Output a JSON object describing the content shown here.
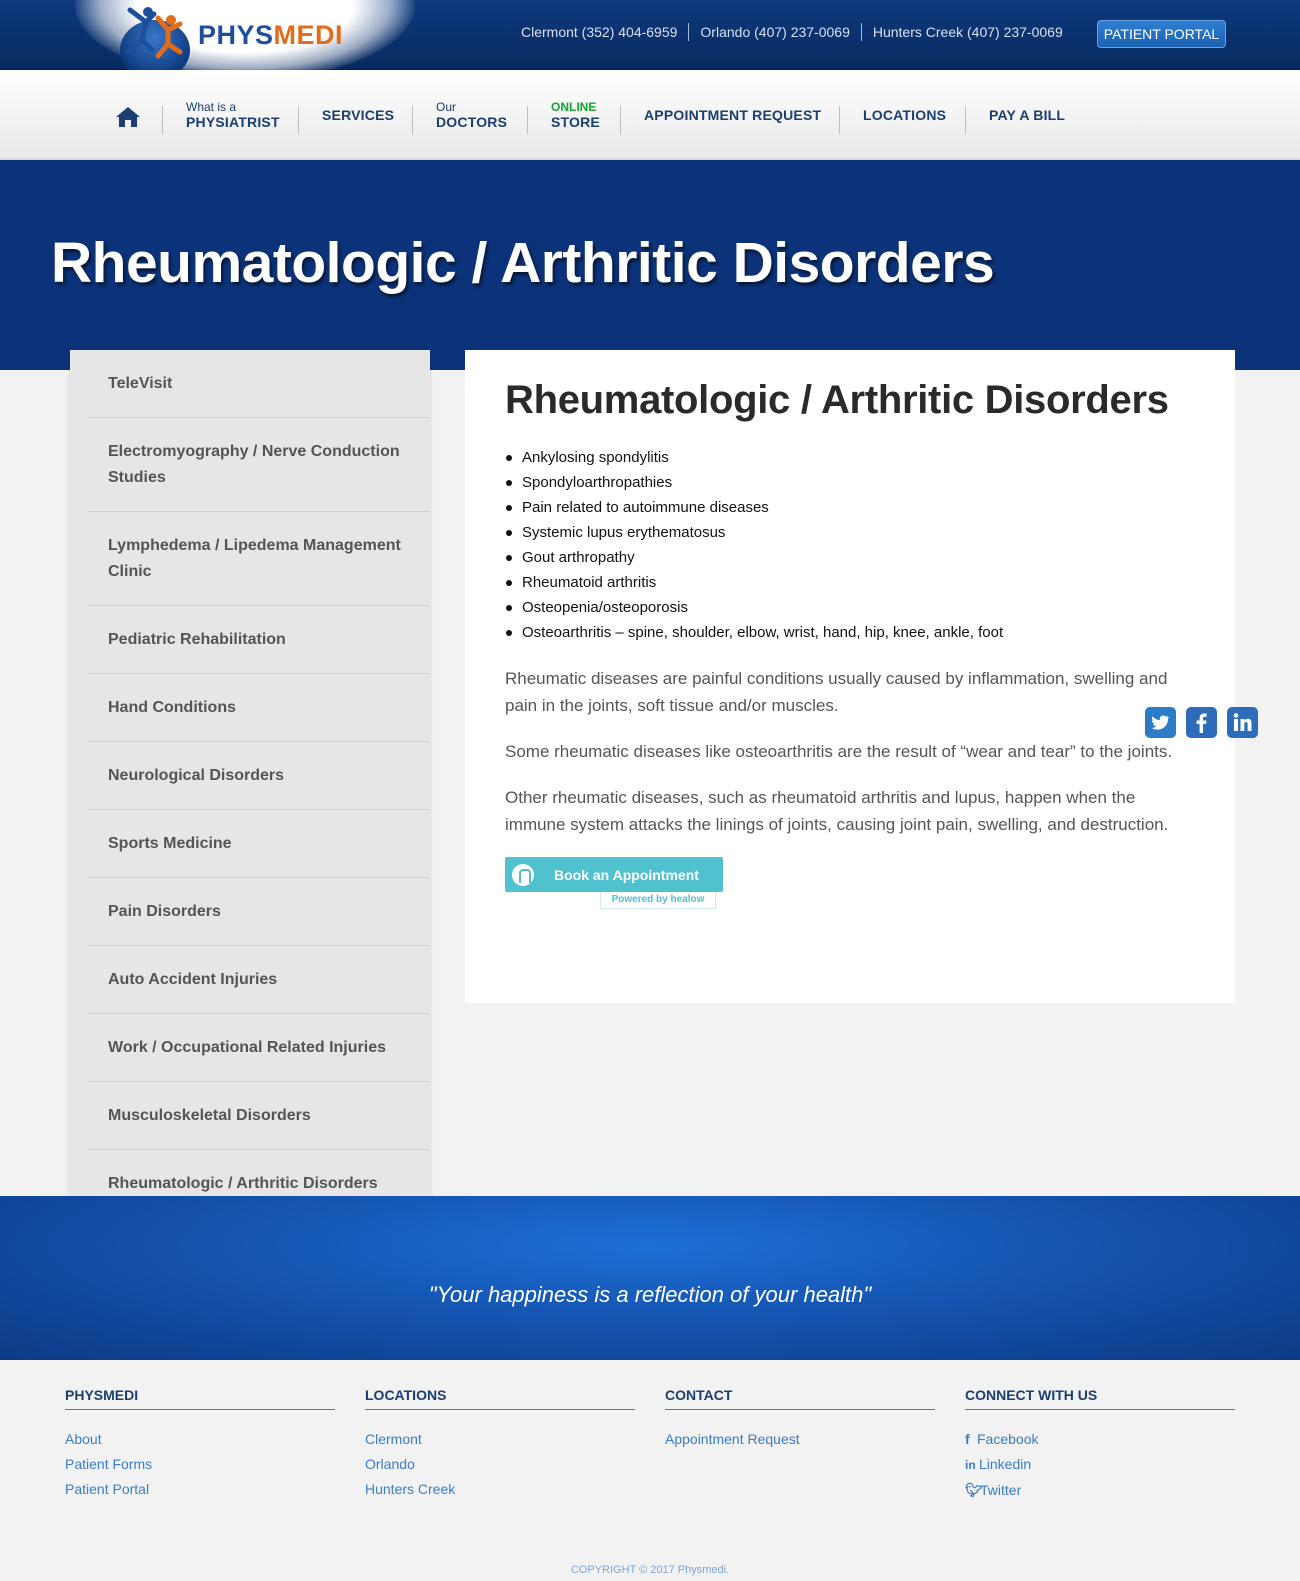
{
  "header": {
    "logo_part1": "PHYS",
    "logo_part2": "MEDI",
    "phones": [
      "Clermont (352) 404-6959",
      "Orlando (407) 237-0069",
      "Hunters Creek (407) 237-0069"
    ],
    "portal_label": "PATIENT PORTAL"
  },
  "nav": {
    "physiatrist_small": "What is a",
    "physiatrist_main": "PHYSIATRIST",
    "services": "SERVICES",
    "doctors_small": "Our",
    "doctors_main": "DOCTORS",
    "store_small": "ONLINE",
    "store_main": "STORE",
    "appointment": "APPOINTMENT REQUEST",
    "locations": "LOCATIONS",
    "pay": "PAY A BILL"
  },
  "hero": {
    "title": "Rheumatologic / Arthritic Disorders"
  },
  "sidebar": {
    "items": [
      "TeleVisit",
      "Electromyography / Nerve Conduction Studies",
      "Lymphedema / Lipedema Management Clinic",
      "Pediatric Rehabilitation",
      "Hand Conditions",
      "Neurological Disorders",
      "Sports Medicine",
      "Pain Disorders",
      "Auto Accident Injuries",
      "Work / Occupational Related Injuries",
      "Musculoskeletal Disorders",
      "Rheumatologic / Arthritic Disorders"
    ]
  },
  "content": {
    "heading": "Rheumatologic / Arthritic Disorders",
    "list": [
      "Ankylosing spondylitis",
      "Spondyloarthropathies",
      "Pain related to autoimmune diseases",
      "Systemic lupus erythematosus",
      "Gout arthropathy",
      "Rheumatoid arthritis",
      "Osteopenia/osteoporosis",
      "Osteoarthritis – spine, shoulder, elbow, wrist, hand, hip, knee, ankle, foot"
    ],
    "paragraphs": [
      "Rheumatic diseases are painful conditions usually caused by inflammation, swelling and pain in the joints, soft tissue and/or muscles.",
      "Some rheumatic diseases like osteoarthritis are the result of “wear and tear” to the joints.",
      "Other rheumatic diseases, such as rheumatoid arthritis and lupus, happen when the immune system attacks the linings of joints, causing joint pain, swelling, and destruction."
    ],
    "book_label": "Book an Appointment",
    "powered_label": "Powered by healow"
  },
  "social": {
    "icons": [
      "twitter-icon",
      "facebook-icon",
      "linkedin-icon"
    ]
  },
  "quote": "\"Your happiness is a reflection of your health\"",
  "footer": {
    "col1_title": "PHYSMEDI",
    "col1_links": [
      "About",
      "Patient Forms",
      "Patient Portal"
    ],
    "col2_title": "LOCATIONS",
    "col2_links": [
      "Clermont",
      "Orlando",
      "Hunters Creek"
    ],
    "col3_title": "CONTACT",
    "col3_links": [
      "Appointment Request"
    ],
    "col4_title": "CONNECT WITH US",
    "col4_links": [
      "Facebook",
      "Linkedin",
      "Twitter"
    ],
    "copyright": "COPYRIGHT © 2017 Physmedi."
  },
  "colors": {
    "brand_blue": "#0c3379",
    "accent_orange": "#e36c1a",
    "link": "#3a7cc7",
    "healow": "#4fc1cf"
  }
}
